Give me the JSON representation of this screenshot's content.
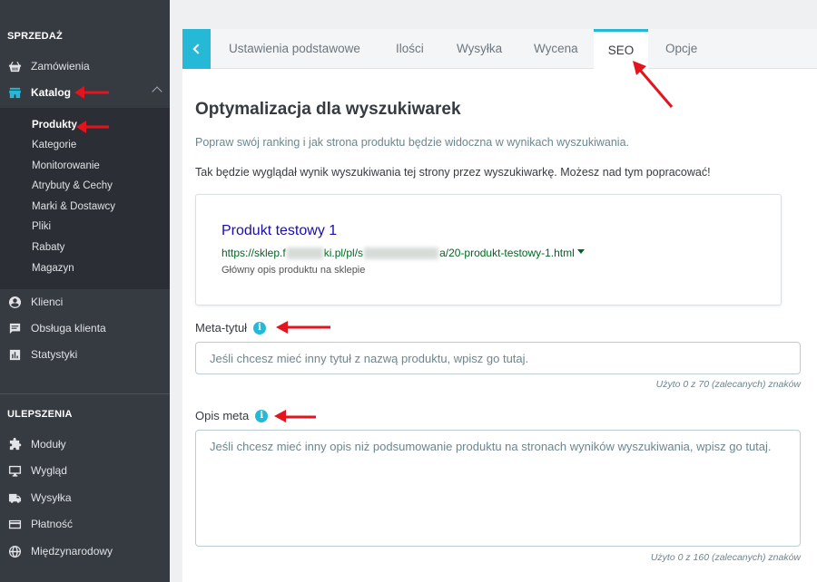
{
  "sidebar": {
    "sales_title": "SPRZEDAŻ",
    "improvements_title": "ULEPSZENIA",
    "sales_items": [
      {
        "label": "Zamówienia",
        "icon": "shopping-basket-icon"
      },
      {
        "label": "Katalog",
        "icon": "store-icon"
      },
      {
        "label": "Klienci",
        "icon": "account-circle-icon"
      },
      {
        "label": "Obsługa klienta",
        "icon": "chat-icon"
      },
      {
        "label": "Statystyki",
        "icon": "bar-chart-icon"
      }
    ],
    "catalog_subitems": [
      "Produkty",
      "Kategorie",
      "Monitorowanie",
      "Atrybuty & Cechy",
      "Marki & Dostawcy",
      "Pliki",
      "Rabaty",
      "Magazyn"
    ],
    "improvement_items": [
      {
        "label": "Moduły",
        "icon": "puzzle-icon"
      },
      {
        "label": "Wygląd",
        "icon": "monitor-icon"
      },
      {
        "label": "Wysyłka",
        "icon": "truck-icon"
      },
      {
        "label": "Płatność",
        "icon": "credit-card-icon"
      },
      {
        "label": "Międzynarodowy",
        "icon": "globe-icon"
      }
    ]
  },
  "tabs": [
    "Ustawienia podstawowe",
    "Ilości",
    "Wysyłka",
    "Wycena",
    "SEO",
    "Opcje"
  ],
  "active_tab": "SEO",
  "seo": {
    "heading": "Optymalizacja dla wyszukiwarek",
    "intro": "Popraw swój ranking i jak strona produktu będzie widoczna w wynikach wyszukiwania.",
    "preview_intro": "Tak będzie wyglądał wynik wyszukiwania tej strony przez wyszukiwarkę. Możesz nad tym popracować!",
    "preview": {
      "title": "Produkt testowy 1",
      "url_part1": "https://sklep.f",
      "url_part2": "ki.pl/pl/s",
      "url_part3": "a/20-produkt-testowy-1.html",
      "description": "Główny opis produktu na sklepie"
    },
    "meta_title_label": "Meta-tytuł",
    "meta_title_placeholder": "Jeśli chcesz mieć inny tytuł z nazwą produktu, wpisz go tutaj.",
    "meta_title_counter": "Użyto 0 z 70 (zalecanych) znaków",
    "meta_desc_label": "Opis meta",
    "meta_desc_placeholder": "Jeśli chcesz mieć inny opis niż podsumowanie produktu na stronach wyników wyszukiwania, wpisz go tutaj.",
    "meta_desc_counter": "Użyto 0 z 160 (zalecanych) znaków"
  },
  "colors": {
    "sidebar_bg": "#363a41",
    "accent": "#25b9d7",
    "annotation_arrow": "#e3141d",
    "link_title": "#1a0dab",
    "link_url": "#006621"
  }
}
